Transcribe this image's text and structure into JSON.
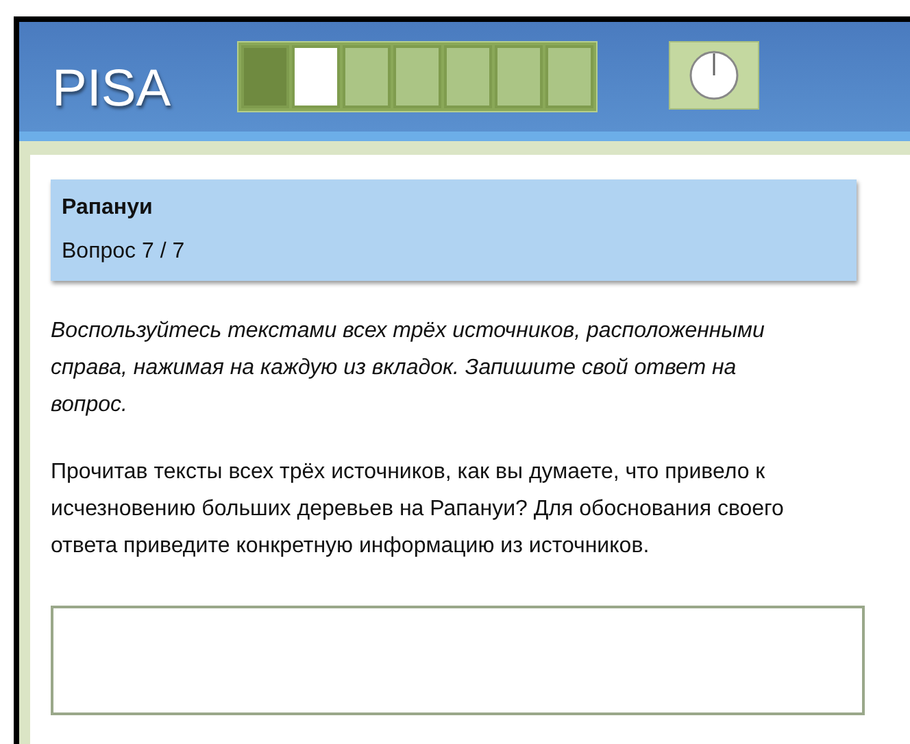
{
  "header": {
    "logo": "PISA"
  },
  "progress": [
    {
      "kind": "done"
    },
    {
      "kind": "current"
    },
    {
      "kind": "pending"
    },
    {
      "kind": "pending"
    },
    {
      "kind": "pending"
    },
    {
      "kind": "pending"
    },
    {
      "kind": "pending"
    }
  ],
  "question_card": {
    "unit": "Рапануи",
    "number": "Вопрос 7 / 7"
  },
  "instruction": "Воспользуйтесь текстами всех трёх источников, расположенными справа, нажимая на каждую из вкладок. Запишите свой ответ на вопрос.",
  "question": "Прочитав тексты всех трёх источников, как вы думаете, что привело к исчезновению больших деревьев на Рапануи? Для обоснования своего ответа приведите конкретную информацию из источников."
}
